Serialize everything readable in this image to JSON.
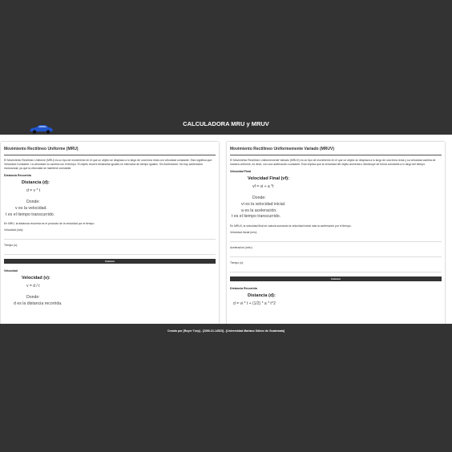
{
  "header": {
    "title": "CALCULADORA MRU y MRUV"
  },
  "colors": {
    "background": "#333333",
    "panel": "#ffffff",
    "button": "#333333",
    "car": "#2255cc"
  },
  "mru": {
    "title": "Movimiento Rectilíneo Uniforme (MRU)",
    "description": "El Movimiento Rectilíneo Uniforme (MRU) es un tipo de movimiento en el que un objeto se desplaza a lo largo de una línea recta con velocidad constante. Esto significa que: Velocidad Constante: La velocidad no cambia con el tiempo. El objeto recorre distancias iguales en intervalos de tiempo iguales. Sin Aceleración: No hay aceleración involucrada, ya que la velocidad se mantiene constante.",
    "distancia": {
      "section_title": "Distancia Recorrida",
      "formula_title": "Distancia (d):",
      "formula": "d = v * t",
      "where": "Donde:",
      "lines": [
        "v es la velocidad.",
        "t es el tiempo transcurrido."
      ],
      "note": "En MRU, la distancia recorrida es el producto de la velocidad por el tiempo.",
      "field_velocidad": "Velocidad (m/s):",
      "field_tiempo": "Tiempo (s):",
      "button": "Calcular"
    },
    "velocidad": {
      "section_title": "Velocidad",
      "formula_title": "Velocidad (v):",
      "formula": "v = d / t",
      "where": "Donde:",
      "lines": [
        "d es la distancia recorrida."
      ]
    }
  },
  "mruv": {
    "title": "Movimiento Rectilíneo Uniformemente Variado (MRUV)",
    "description": "El Movimiento Rectilíneo Uniformemente Variado (MRUV) es un tipo de movimiento en el que un objeto se desplaza a lo largo de una línea recta y su velocidad cambia de manera uniforme, es decir, con una aceleración constante. Esto implica que la velocidad del objeto aumenta o disminuye de forma constante a lo largo del tiempo.",
    "velfinal": {
      "section_title": "Velocidad Final",
      "formula_title": "Velocidad Final (vf):",
      "formula": "vf = vi + a *t",
      "where": "Donde:",
      "lines": [
        "vi es la velocidad inicial.",
        "a es la aceleración.",
        "t es el tiempo transcurrido."
      ],
      "note": "En MRUV, la velocidad final se calcula sumando la velocidad inicial más la aceleración por el tiempo.",
      "field_vi": "Velocidad Inicial (m/s):",
      "field_a": "Aceleración (m/s²):",
      "field_t": "Tiempo (s):",
      "button": "Calcular"
    },
    "distancia": {
      "section_title": "Distancia Recorrida",
      "formula_title": "Distancia (d):",
      "formula": "d = vi * t + (1/2) * a * t^2"
    }
  },
  "footer": {
    "text": "Creado por [Royer Tzep] - [2390-21-14523] - [Universidad Mariano Gálvez de Guatemala]"
  }
}
